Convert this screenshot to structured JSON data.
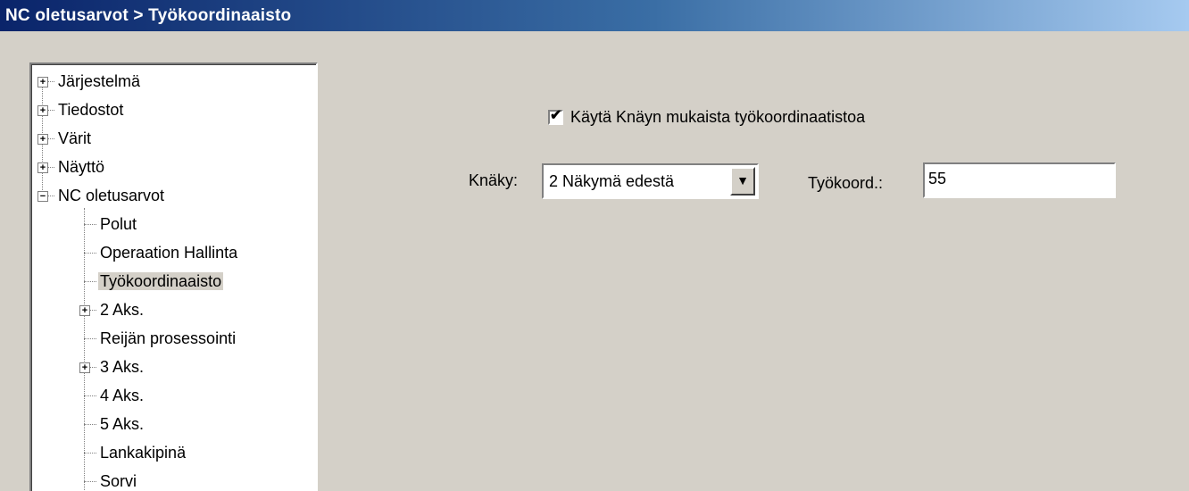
{
  "title": "NC oletusarvot > Työkoordinaaisto",
  "tree": [
    {
      "label": "Järjestelmä",
      "level": 0,
      "expand": "+"
    },
    {
      "label": "Tiedostot",
      "level": 0,
      "expand": "+"
    },
    {
      "label": "Värit",
      "level": 0,
      "expand": "+"
    },
    {
      "label": "Näyttö",
      "level": 0,
      "expand": "+"
    },
    {
      "label": "NC oletusarvot",
      "level": 0,
      "expand": "-"
    },
    {
      "label": "Polut",
      "level": 1,
      "expand": ""
    },
    {
      "label": "Operaation Hallinta",
      "level": 1,
      "expand": ""
    },
    {
      "label": "Työkoordinaaisto",
      "level": 1,
      "expand": "",
      "selected": true
    },
    {
      "label": "2 Aks.",
      "level": 1,
      "expand": "+"
    },
    {
      "label": "Reijän prosessointi",
      "level": 1,
      "expand": ""
    },
    {
      "label": "3 Aks.",
      "level": 1,
      "expand": "+"
    },
    {
      "label": "4 Aks.",
      "level": 1,
      "expand": ""
    },
    {
      "label": "5 Aks.",
      "level": 1,
      "expand": ""
    },
    {
      "label": "Lankakipinä",
      "level": 1,
      "expand": ""
    },
    {
      "label": "Sorvi",
      "level": 1,
      "expand": ""
    }
  ],
  "settings": {
    "use_knaky_label": "Käytä Knäyn mukaista työkoordinaatistoa",
    "use_knaky_checked": true,
    "knaky_label": "Knäky:",
    "knaky_value": "2  Näkymä edestä",
    "tyokoord_label": "Työkoord.:",
    "tyokoord_value": "55"
  },
  "icons": {
    "dropdown": "chevron-down-icon",
    "checkmark": "checkmark-icon"
  }
}
